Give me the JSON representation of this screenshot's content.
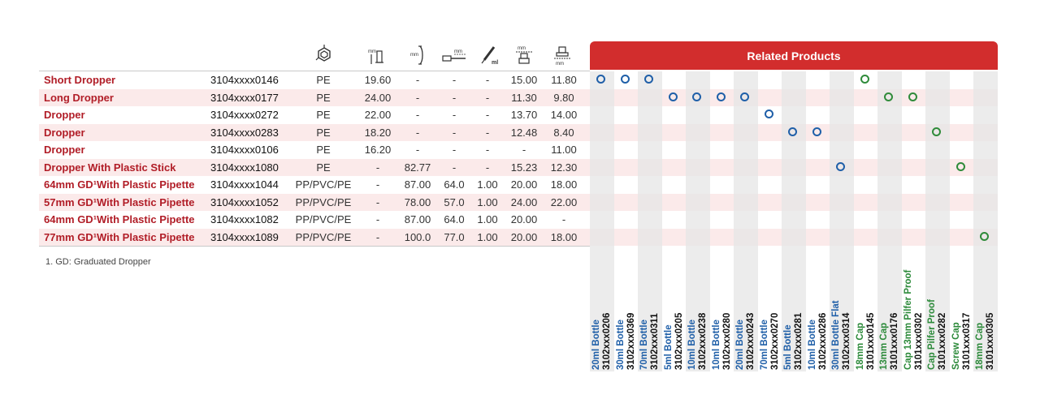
{
  "table": {
    "column_icons": [
      "neck-finish-icon",
      "height-icon",
      "length-icon",
      "dropper-length-icon",
      "capacity-icon",
      "diameter-icon",
      "cap-diameter-icon"
    ],
    "rows": [
      {
        "name": "Short Dropper",
        "code": "3104xxxx0146",
        "material": "PE",
        "c1": "19.60",
        "c2": "-",
        "c3": "-",
        "c4": "-",
        "c5": "15.00",
        "c6": "11.80"
      },
      {
        "name": "Long Dropper",
        "code": "3104xxxx0177",
        "material": "PE",
        "c1": "24.00",
        "c2": "-",
        "c3": "-",
        "c4": "-",
        "c5": "11.30",
        "c6": "9.80"
      },
      {
        "name": "Dropper",
        "code": "3104xxxx0272",
        "material": "PE",
        "c1": "22.00",
        "c2": "-",
        "c3": "-",
        "c4": "-",
        "c5": "13.70",
        "c6": "14.00"
      },
      {
        "name": "Dropper",
        "code": "3104xxxx0283",
        "material": "PE",
        "c1": "18.20",
        "c2": "-",
        "c3": "-",
        "c4": "-",
        "c5": "12.48",
        "c6": "8.40"
      },
      {
        "name": "Dropper",
        "code": "3104xxxx0106",
        "material": "PE",
        "c1": "16.20",
        "c2": "-",
        "c3": "-",
        "c4": "-",
        "c5": "-",
        "c6": "11.00"
      },
      {
        "name": "Dropper With Plastic Stick",
        "code": "3104xxxx1080",
        "material": "PE",
        "c1": "-",
        "c2": "82.77",
        "c3": "-",
        "c4": "-",
        "c5": "15.23",
        "c6": "12.30"
      },
      {
        "name": "64mm GD¹With Plastic Pipette",
        "code": "3104xxxx1044",
        "material": "PP/PVC/PE",
        "c1": "-",
        "c2": "87.00",
        "c3": "64.0",
        "c4": "1.00",
        "c5": "20.00",
        "c6": "18.00"
      },
      {
        "name": "57mm GD¹With Plastic Pipette",
        "code": "3104xxxx1052",
        "material": "PP/PVC/PE",
        "c1": "-",
        "c2": "78.00",
        "c3": "57.0",
        "c4": "1.00",
        "c5": "24.00",
        "c6": "22.00"
      },
      {
        "name": "64mm GD¹With Plastic Pipette",
        "code": "3104xxxx1082",
        "material": "PP/PVC/PE",
        "c1": "-",
        "c2": "87.00",
        "c3": "64.0",
        "c4": "1.00",
        "c5": "20.00",
        "c6": "-"
      },
      {
        "name": "77mm GD¹With Plastic Pipette",
        "code": "3104xxxx1089",
        "material": "PP/PVC/PE",
        "c1": "-",
        "c2": "100.0",
        "c3": "77.0",
        "c4": "1.00",
        "c5": "20.00",
        "c6": "18.00"
      }
    ],
    "footnote": "1. GD: Graduated Dropper"
  },
  "related": {
    "title": "Related Products",
    "products": [
      {
        "name": "20ml Bottle",
        "code": "3102xxx0206",
        "kind": "bottle"
      },
      {
        "name": "30ml Bottle",
        "code": "3102xxx0369",
        "kind": "bottle"
      },
      {
        "name": "70ml Bottle",
        "code": "3102xxx0311",
        "kind": "bottle"
      },
      {
        "name": "5ml Bottle",
        "code": "3102xxx0205",
        "kind": "bottle"
      },
      {
        "name": "10ml Bottle",
        "code": "3102xxx0238",
        "kind": "bottle"
      },
      {
        "name": "10ml Bottle",
        "code": "3102xxx0280",
        "kind": "bottle"
      },
      {
        "name": "20ml Bottle",
        "code": "3102xxx0243",
        "kind": "bottle"
      },
      {
        "name": "70ml Bottle",
        "code": "3102xxx0270",
        "kind": "bottle"
      },
      {
        "name": "5ml Bottle",
        "code": "3102xxx0281",
        "kind": "bottle"
      },
      {
        "name": "10ml Bottle",
        "code": "3102xxx0286",
        "kind": "bottle"
      },
      {
        "name": "30ml Bottle Flat",
        "code": "3102xxx0314",
        "kind": "bottle"
      },
      {
        "name": "18mm Cap",
        "code": "3101xxx0145",
        "kind": "cap"
      },
      {
        "name": "13mm Cap",
        "code": "3101xxx0176",
        "kind": "cap"
      },
      {
        "name": "Cap 13mm Pilfer Proof",
        "code": "3101xxx0302",
        "kind": "cap"
      },
      {
        "name": "Cap Pilfer Proof",
        "code": "3101xxx0282",
        "kind": "cap"
      },
      {
        "name": "Screw Cap",
        "code": "3101xxx0317",
        "kind": "cap"
      },
      {
        "name": "18mm Cap",
        "code": "3101xxx0305",
        "kind": "cap"
      }
    ],
    "matches": [
      {
        "row": 0,
        "col": 0
      },
      {
        "row": 0,
        "col": 1
      },
      {
        "row": 0,
        "col": 2
      },
      {
        "row": 0,
        "col": 11
      },
      {
        "row": 1,
        "col": 3
      },
      {
        "row": 1,
        "col": 4
      },
      {
        "row": 1,
        "col": 5
      },
      {
        "row": 1,
        "col": 6
      },
      {
        "row": 1,
        "col": 12
      },
      {
        "row": 1,
        "col": 13
      },
      {
        "row": 2,
        "col": 7
      },
      {
        "row": 3,
        "col": 8
      },
      {
        "row": 3,
        "col": 9
      },
      {
        "row": 3,
        "col": 14
      },
      {
        "row": 5,
        "col": 10
      },
      {
        "row": 5,
        "col": 15
      },
      {
        "row": 9,
        "col": 16
      }
    ]
  },
  "colors": {
    "accent_red": "#d22d2d",
    "name_red": "#b11d27",
    "bottle_blue": "#1f5fa8",
    "cap_green": "#2f8b3a",
    "row_tint": "#fbeaea",
    "stripe_grey": "#e6e6e6"
  }
}
